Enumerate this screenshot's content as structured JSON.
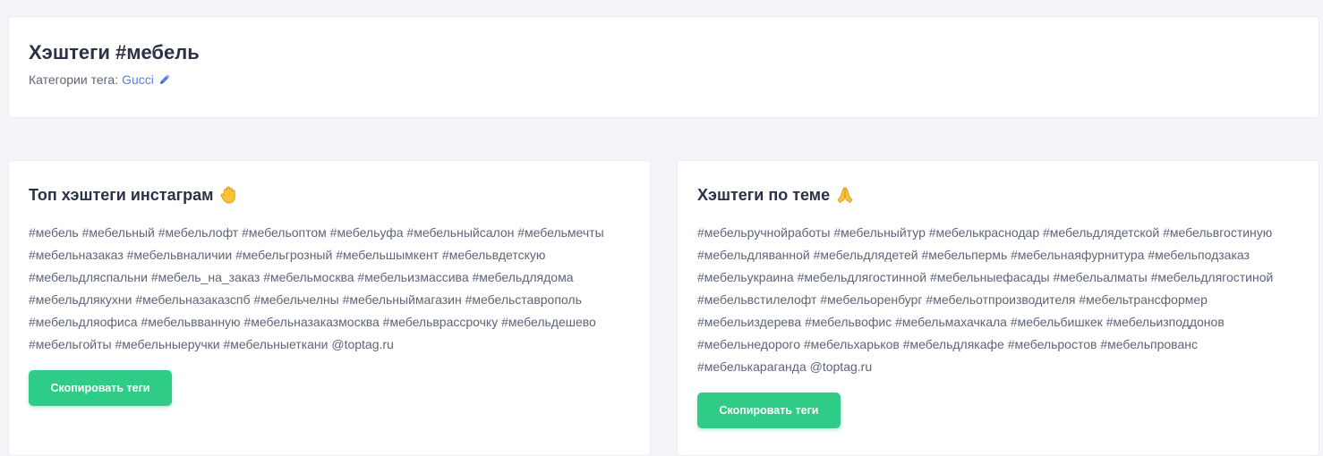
{
  "header": {
    "title": "Хэштеги #мебель",
    "categories_label": "Категории тега:",
    "category_link": "Gucci"
  },
  "left": {
    "title": "Топ хэштеги инстаграм",
    "emoji_icon": "raised-hand-icon",
    "tags": "#мебель #мебельный #мебельлофт #мебельоптом #мебельуфа #мебельныйсалон #мебельмечты #мебельназаказ #мебельвналичии #мебельгрозный #мебельшымкент #мебельвдетскую #мебельдляспальни #мебель_на_заказ #мебельмосква #мебельизмассива #мебельдлядома #мебельдлякухни #мебельназаказспб #мебельчелны #мебельныймагазин #мебельставрополь #мебельдляофиса #мебельвванную #мебельназаказмосква #мебельврассрочку #мебельдешево #мебельгойты #мебельныеручки #мебельныеткани @toptag.ru",
    "button": "Скопировать теги"
  },
  "right": {
    "title": "Хэштеги по теме",
    "emoji_icon": "folded-hands-icon",
    "tags": "#мебельручнойработы #мебельныйтур #мебелькраснодар #мебельдлядетской #мебельвгостиную #мебельдляванной #мебельдлядетей #мебельпермь #мебельнаяфурнитура #мебельподзаказ #мебельукраина #мебельдлягостинной #мебельныефасады #мебельалматы #мебельдлягостиной #мебельвстилелофт #мебельоренбург #мебельотпроизводителя #мебельтрансформер #мебельиздерева #мебельвофис #мебельмахачкала #мебельбишкек #мебельизподдонов #мебельнедорого #мебельхарьков #мебельдлякафе #мебельростов #мебельпрованс #мебелькараганда @toptag.ru",
    "button": "Скопировать теги"
  },
  "colors": {
    "accent_green": "#2ecc87",
    "link_blue": "#5b7be8"
  }
}
